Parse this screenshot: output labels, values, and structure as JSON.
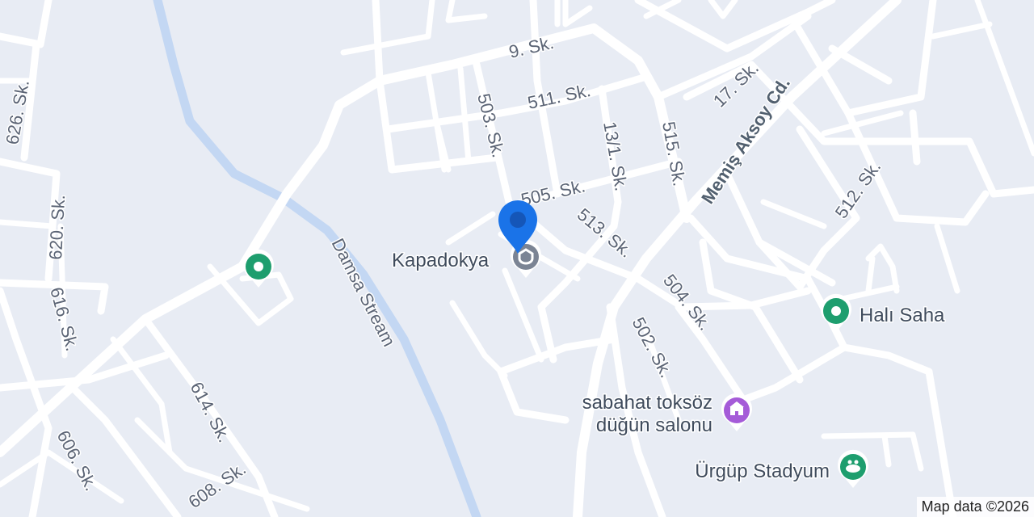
{
  "colors": {
    "background": "#e8ecf4",
    "road": "#ffffff",
    "stream": "#c3d7f3",
    "park_pin": "#1e9e6e",
    "venue_pin": "#a55bd8",
    "school_pin": "#7b8494",
    "location_pin": "#1a73e8"
  },
  "streets": {
    "s626": "626. Sk.",
    "s620": "620. Sk.",
    "s616": "616. Sk.",
    "s614": "614. Sk.",
    "s606": "606. Sk.",
    "s608": "608. Sk.",
    "s9": "9. Sk.",
    "s511": "511. Sk.",
    "s503": "503. Sk.",
    "s505": "505. Sk.",
    "s13_1": "13/1. Sk.",
    "s513": "513. Sk.",
    "s515": "515. Sk.",
    "s17": "17. Sk.",
    "memis": "Memiş Aksoy Cd.",
    "s512": "512. Sk.",
    "s504": "504. Sk.",
    "s502": "502. Sk."
  },
  "water": {
    "stream": "Damsa Stream"
  },
  "places": {
    "kapadokya": {
      "name": "Kapadokya",
      "icon": "school-icon"
    },
    "hali_saha": {
      "name": "Halı Saha",
      "icon": "park-icon"
    },
    "dugun": {
      "line1": "sabahat toksöz",
      "line2": "düğün salonu",
      "icon": "wedding-hall-icon"
    },
    "stadyum": {
      "name": "Ürgüp Stadyum",
      "icon": "stadium-icon"
    },
    "park": {
      "icon": "park-icon"
    }
  },
  "attribution": "Map data ©2026"
}
